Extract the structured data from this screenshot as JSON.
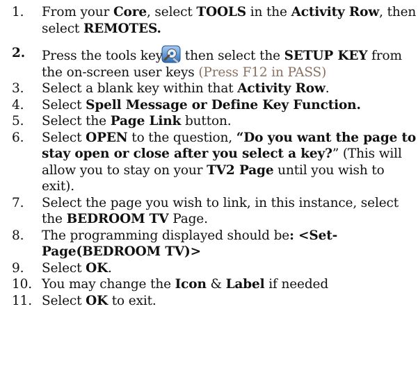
{
  "steps": [
    {
      "number": "1.",
      "parts": [
        "From your ",
        "Core",
        ", select ",
        "TOOLS",
        " in the ",
        "Activity Row",
        ", then select ",
        "REMOTES."
      ]
    },
    {
      "number": "2.",
      "parts": [
        "Press the tools key",
        " then select the ",
        "SETUP KEY",
        " from the on-screen user keys ",
        "(Press F12 in PASS)"
      ],
      "icon": "tools-key-icon"
    },
    {
      "number": "3.",
      "parts": [
        "Select a blank key within that ",
        "Activity Row",
        "."
      ]
    },
    {
      "number": "4.",
      "parts": [
        "Select ",
        "Spell Message or Define Key Function."
      ]
    },
    {
      "number": "5.",
      "parts": [
        "Select the ",
        "Page Link",
        " button."
      ]
    },
    {
      "number": "6.",
      "parts": [
        "Select ",
        "OPEN",
        " to the question, ",
        "“Do you want the page to stay open or close after you select a key?",
        "” (This will allow you to stay on your ",
        "TV2 Page",
        " until you wish to exit)."
      ]
    },
    {
      "number": "7.",
      "parts": [
        "Select the page you wish to link, in this instance, select the ",
        "BEDROOM TV",
        " Page."
      ]
    },
    {
      "number": "8.",
      "parts": [
        "The programming displayed should be",
        ": <Set-Page(BEDROOM TV)>"
      ]
    },
    {
      "number": "9.",
      "parts": [
        "Select ",
        "OK",
        "."
      ]
    },
    {
      "number": "10.",
      "parts": [
        "You may change the ",
        "Icon",
        " & ",
        "Label",
        " if needed"
      ]
    },
    {
      "number": "11.",
      "parts": [
        "Select ",
        "OK",
        " to exit."
      ]
    }
  ],
  "colors": {
    "text": "#111111",
    "hint": "#8a7060",
    "icon_blue": "#2f6fb8"
  }
}
